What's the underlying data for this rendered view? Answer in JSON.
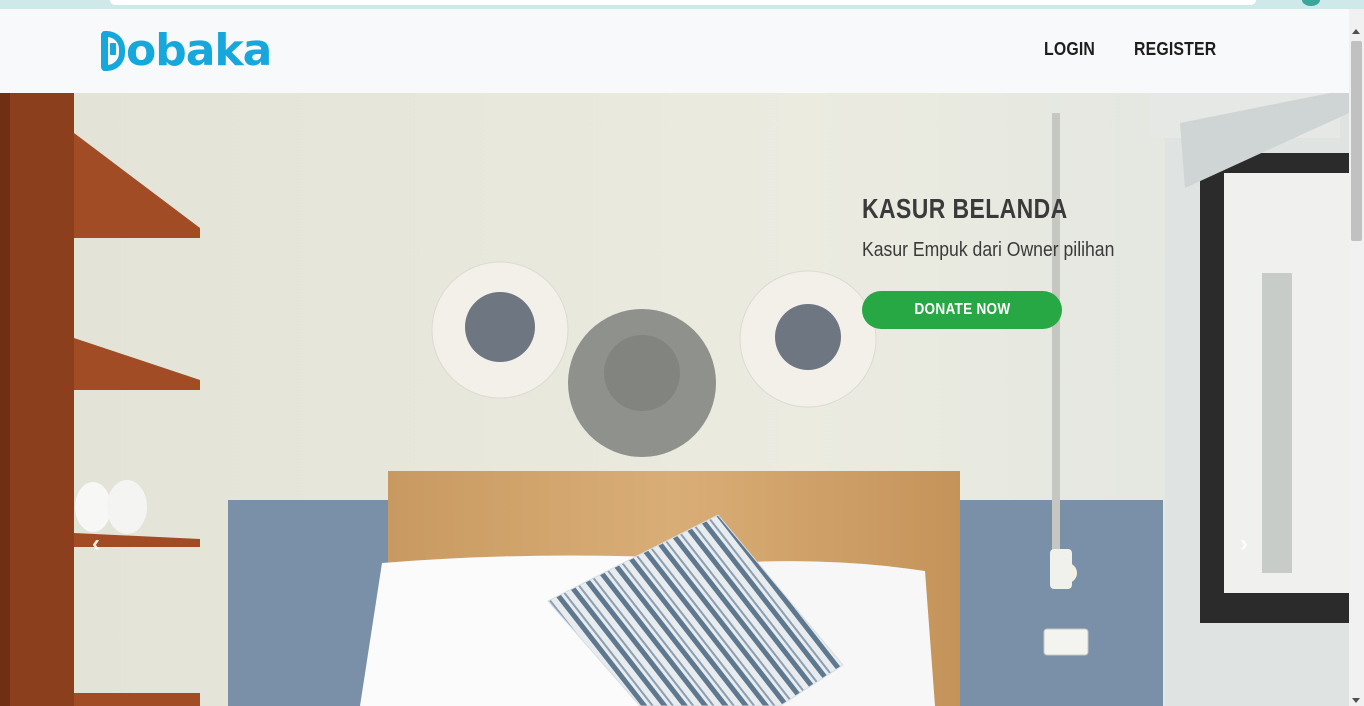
{
  "brand": {
    "name": "obaka",
    "icon": "phone-d-logo-icon",
    "color": "#16a8dc"
  },
  "nav": {
    "login": "LOGIN",
    "register": "REGISTER"
  },
  "carousel": {
    "title": "KASUR BELANDA",
    "subtitle": "Kasur Empuk dari Owner pilihan",
    "cta": "DONATE NOW",
    "cta_color": "#28a745",
    "prev_icon": "chevron-left-icon",
    "next_icon": "chevron-right-icon",
    "prev_glyph": "‹",
    "next_glyph": "›"
  }
}
